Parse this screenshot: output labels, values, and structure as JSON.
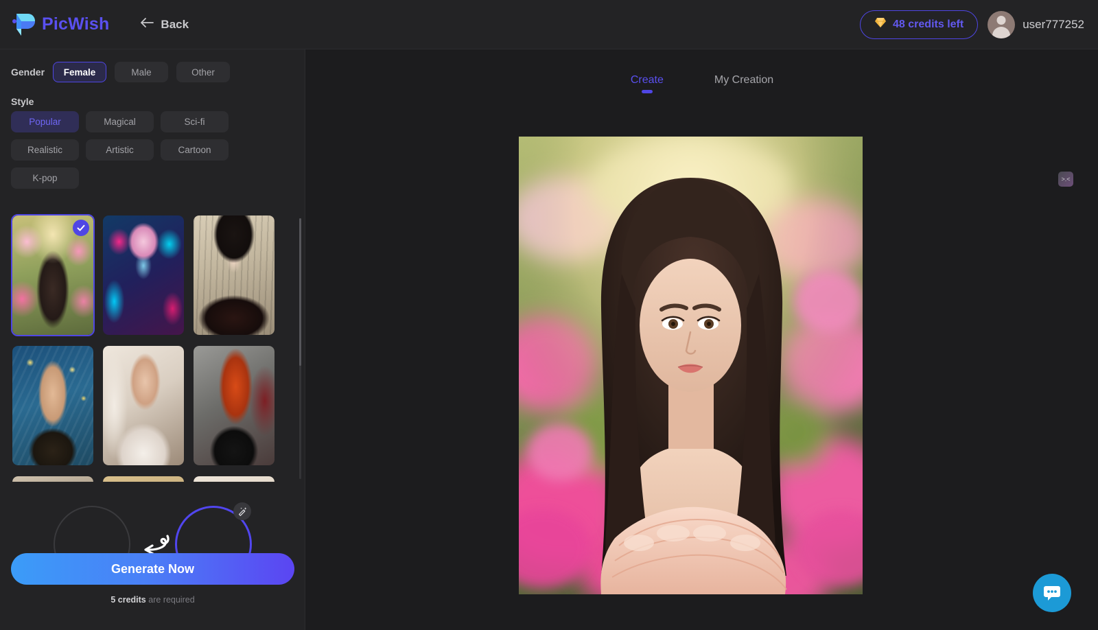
{
  "app": {
    "brand": "PicWish",
    "back_label": "Back",
    "logo_icon": "picwish-logo-icon"
  },
  "header": {
    "credits_label": "48 credits left",
    "credits_icon": "diamond-icon",
    "username": "user777252",
    "avatar_icon": "user-avatar-icon",
    "accent_color": "#4f46e5",
    "credits_text_color": "#6259ef"
  },
  "sidebar": {
    "gender": {
      "label": "Gender",
      "options": [
        {
          "label": "Female",
          "selected": true
        },
        {
          "label": "Male",
          "selected": false
        },
        {
          "label": "Other",
          "selected": false
        }
      ]
    },
    "style": {
      "label": "Style",
      "options": [
        {
          "label": "Popular",
          "selected": true
        },
        {
          "label": "Magical",
          "selected": false
        },
        {
          "label": "Sci-fi",
          "selected": false
        },
        {
          "label": "Realistic",
          "selected": false
        },
        {
          "label": "Artistic",
          "selected": false
        },
        {
          "label": "Cartoon",
          "selected": false
        },
        {
          "label": "K-pop",
          "selected": false
        }
      ]
    },
    "thumbnails": [
      {
        "name": "flower-garden-portrait",
        "art": "art-flower",
        "selected": true
      },
      {
        "name": "neon-cyberpunk-portrait",
        "art": "art-neon",
        "selected": false
      },
      {
        "name": "gothic-vintage-portrait",
        "art": "art-gothic",
        "selected": false
      },
      {
        "name": "van-gogh-painting-portrait",
        "art": "art-vangogh",
        "selected": false
      },
      {
        "name": "white-lace-window-portrait",
        "art": "art-lace",
        "selected": false
      },
      {
        "name": "red-hair-punk-portrait",
        "art": "art-punk",
        "selected": false
      },
      {
        "name": "hallway-portrait",
        "art": "art-hall",
        "selected": false
      },
      {
        "name": "fluffy-hair-portrait",
        "art": "art-fluff",
        "selected": false
      },
      {
        "name": "bright-room-portrait",
        "art": "art-bright",
        "selected": false
      }
    ],
    "check_icon": "checkmark-icon",
    "swap_icon": "curved-arrow-icon",
    "edit_icon": "magic-wand-icon",
    "generate_label": "Generate Now",
    "credits_note_amount": "5 credits",
    "credits_note_rest": " are required"
  },
  "main": {
    "tabs": [
      {
        "label": "Create",
        "active": true
      },
      {
        "label": "My Creation",
        "active": false
      }
    ],
    "preview_name": "flower-garden-portrait-preview",
    "side_tool_icon": "emoticon-face-icon",
    "side_tool_label": ">.<",
    "chat_icon": "chat-bubble-icon"
  }
}
